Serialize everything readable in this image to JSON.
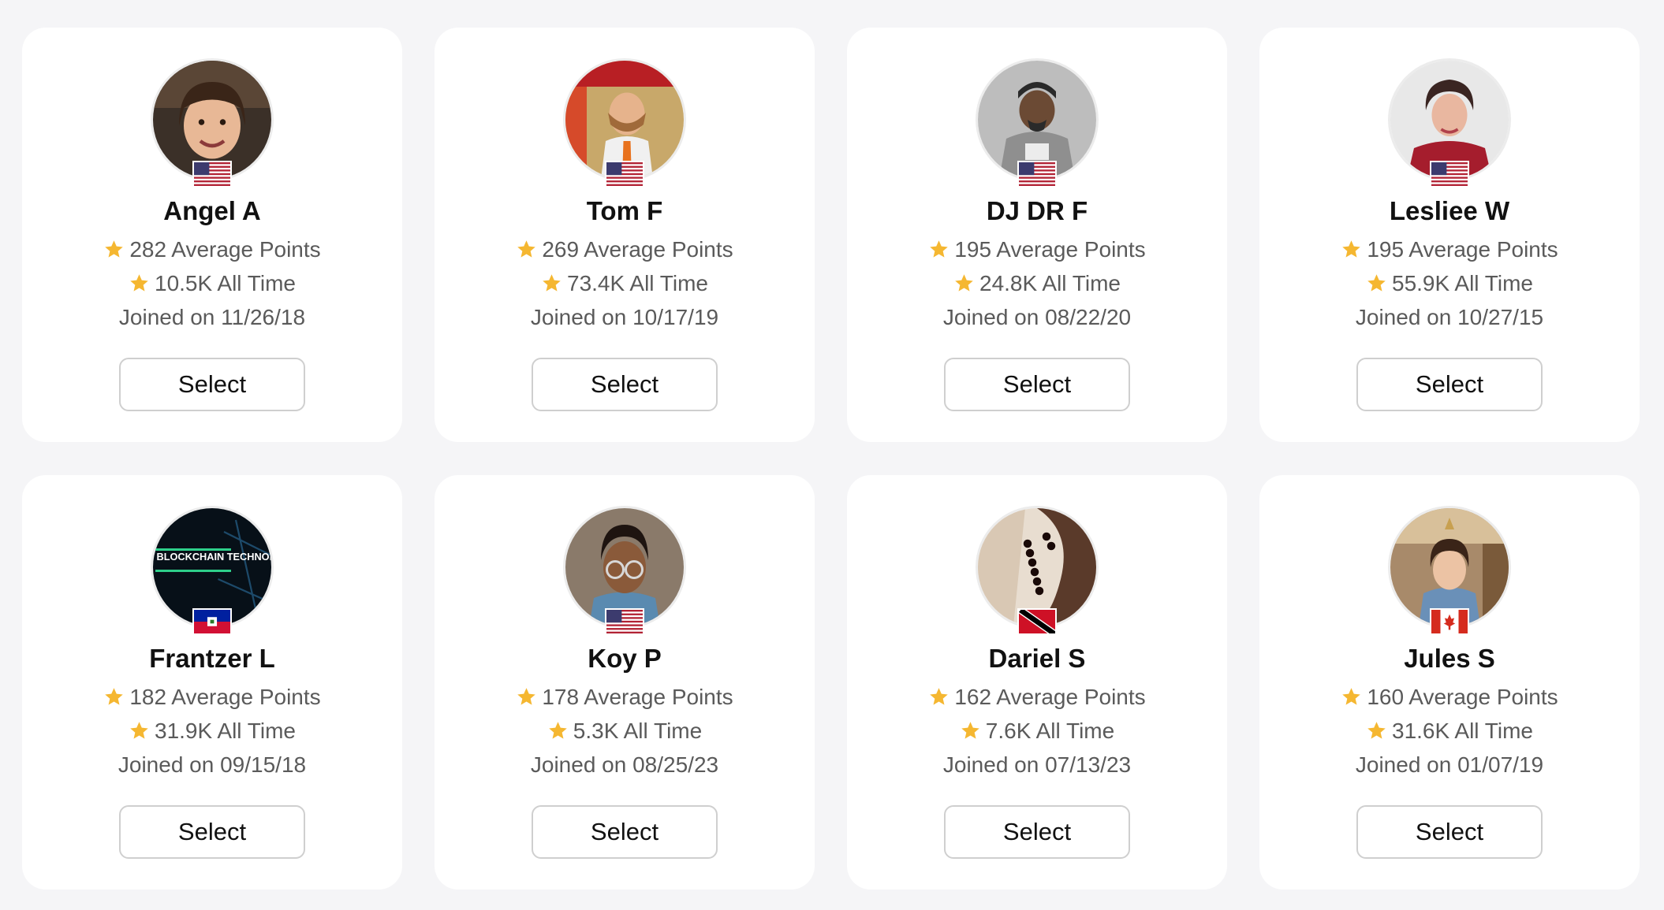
{
  "colors": {
    "background": "#f5f5f7",
    "card": "#ffffff",
    "star": "#f5b731",
    "text_primary": "#111111",
    "text_secondary": "#5a5a5a",
    "button_border": "#cfcfcf"
  },
  "users": [
    {
      "name": "Angel A",
      "average_points": "282 Average Points",
      "all_time": "10.5K All Time",
      "joined": "Joined on 11/26/18",
      "select_label": "Select",
      "flag": "us-flag-icon"
    },
    {
      "name": "Tom F",
      "average_points": "269 Average Points",
      "all_time": "73.4K All Time",
      "joined": "Joined on 10/17/19",
      "select_label": "Select",
      "flag": "us-flag-icon"
    },
    {
      "name": "DJ DR F",
      "average_points": "195 Average Points",
      "all_time": "24.8K All Time",
      "joined": "Joined on 08/22/20",
      "select_label": "Select",
      "flag": "us-flag-icon"
    },
    {
      "name": "Lesliee W",
      "average_points": "195 Average Points",
      "all_time": "55.9K All Time",
      "joined": "Joined on 10/27/15",
      "select_label": "Select",
      "flag": "us-flag-icon"
    },
    {
      "name": "Frantzer L",
      "average_points": "182 Average Points",
      "all_time": "31.9K All Time",
      "joined": "Joined on 09/15/18",
      "select_label": "Select",
      "flag": "haiti-flag-icon",
      "avatar_text": "BLOCKCHAIN TECHNOLOGY"
    },
    {
      "name": "Koy P",
      "average_points": "178 Average Points",
      "all_time": "5.3K All Time",
      "joined": "Joined on 08/25/23",
      "select_label": "Select",
      "flag": "us-flag-icon"
    },
    {
      "name": "Dariel S",
      "average_points": "162 Average Points",
      "all_time": "7.6K All Time",
      "joined": "Joined on 07/13/23",
      "select_label": "Select",
      "flag": "trinidad-flag-icon"
    },
    {
      "name": "Jules S",
      "average_points": "160 Average Points",
      "all_time": "31.6K All Time",
      "joined": "Joined on 01/07/19",
      "select_label": "Select",
      "flag": "canada-flag-icon"
    }
  ]
}
